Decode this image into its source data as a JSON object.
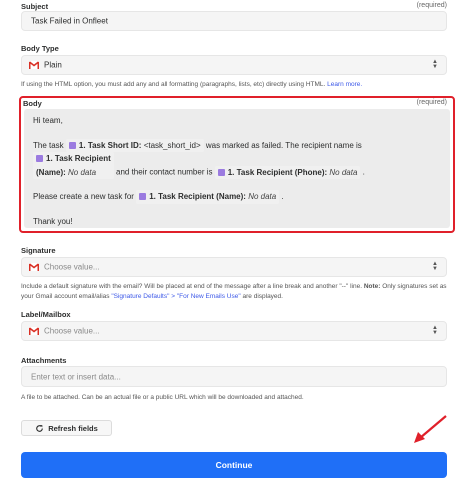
{
  "subject": {
    "label": "Subject",
    "required": "(required)",
    "value": "Task Failed in Onfleet"
  },
  "body_type": {
    "label": "Body Type",
    "value": "Plain",
    "help_text": "If using the HTML option, you must add any and all formatting (paragraphs, lists, etc) directly using HTML.",
    "help_link": "Learn more."
  },
  "body": {
    "label": "Body",
    "required": "(required)",
    "greeting": "Hi team,",
    "line2_prefix": "The task",
    "task_short_id_label": "1. Task Short ID:",
    "task_short_id_value": "<task_short_id>",
    "line2_mid": "was marked as failed. The recipient name is",
    "task_recipient_name_label": "1. Task Recipient",
    "task_recipient_name_label2": "(Name):",
    "no_data": "No data",
    "line2_mid2": "and their contact number is",
    "task_recipient_phone_label": "1. Task Recipient (Phone):",
    "line2_end": ".",
    "line3_prefix": "Please create a new task for",
    "task_recipient_name_full": "1. Task Recipient (Name):",
    "line3_end": ".",
    "signoff": "Thank you!"
  },
  "signature": {
    "label": "Signature",
    "placeholder": "Choose value...",
    "help_part1": "Include a default signature with the email? Will be placed at end of the message after a line break and another \"--\" line.",
    "help_note": "Note:",
    "help_part2": "Only signatures set as your Gmail account email/alias",
    "help_link": "\"Signature Defaults\" > \"For New Emails Use\"",
    "help_part3": "are displayed."
  },
  "label_mailbox": {
    "label": "Label/Mailbox",
    "placeholder": "Choose value..."
  },
  "attachments": {
    "label": "Attachments",
    "placeholder": "Enter text or insert data...",
    "help_text": "A file to be attached. Can be an actual file or a public URL which will be downloaded and attached."
  },
  "buttons": {
    "refresh": "Refresh fields",
    "continue": "Continue"
  },
  "colors": {
    "primary_button": "#1f6ff7",
    "highlight_border": "#e0202a",
    "pill_square": "#9b7be0",
    "link": "#3d59e8"
  },
  "icons": {
    "gmail": "gmail-icon",
    "updown": "select-chevron-icon",
    "refresh": "refresh-icon",
    "arrow": "annotation-arrow-icon"
  }
}
